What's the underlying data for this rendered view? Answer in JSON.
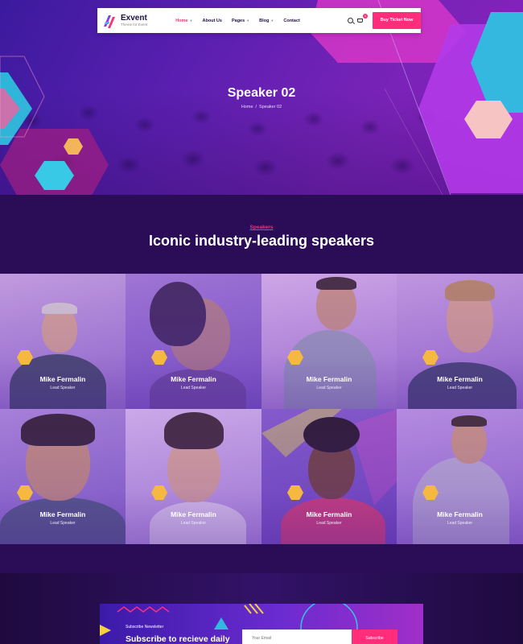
{
  "brand": {
    "name": "Exvent",
    "tagline": "Theme for Event",
    "colors": {
      "accent": "#ff2d7a",
      "primary": "#5a1fb0",
      "dark": "#2a0d56"
    }
  },
  "nav": {
    "items": [
      {
        "label": "Home",
        "active": true,
        "dropdown": true
      },
      {
        "label": "About Us",
        "active": false,
        "dropdown": false
      },
      {
        "label": "Pages",
        "active": false,
        "dropdown": true
      },
      {
        "label": "Blog",
        "active": false,
        "dropdown": true
      },
      {
        "label": "Contact",
        "active": false,
        "dropdown": false
      }
    ],
    "cart_count": "0",
    "cta_label": "Buy Ticket Now",
    "icons": [
      "search-icon",
      "cart-icon"
    ]
  },
  "hero": {
    "title": "Speaker 02",
    "breadcrumb": {
      "home": "Home",
      "separator": "/",
      "current": "Speaker 02"
    }
  },
  "speakers_section": {
    "eyebrow": "Speakers",
    "title": "Iconic industry-leading speakers",
    "speakers": [
      {
        "name": "Mike Fermalin",
        "role": "Lead Speaker"
      },
      {
        "name": "Mike Fermalin",
        "role": "Lead Speaker"
      },
      {
        "name": "Mike Fermalin",
        "role": "Lead Speaker"
      },
      {
        "name": "Mike Fermalin",
        "role": "Lead Speaker"
      },
      {
        "name": "Mike Fermalin",
        "role": "Lead Speaker"
      },
      {
        "name": "Mike Fermalin",
        "role": "Lead Speaker"
      },
      {
        "name": "Mike Fermalin",
        "role": "Lead Speaker"
      },
      {
        "name": "Mike Fermalin",
        "role": "Lead Speaker"
      }
    ]
  },
  "newsletter": {
    "eyebrow": "Subscribe Newsletter",
    "title": "Subscribe to recieve daily",
    "input_placeholder": "Your Email",
    "button_label": "Subscribe"
  }
}
